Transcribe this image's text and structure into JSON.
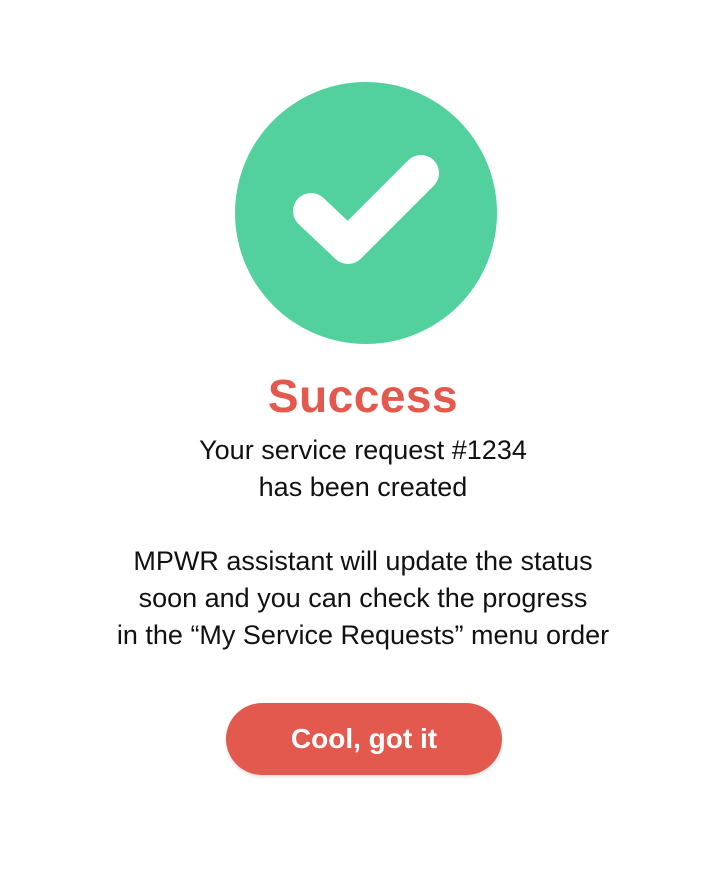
{
  "dialog": {
    "status_icon": "check-circle-icon",
    "title": "Success",
    "message_lines": [
      "Your service request #1234",
      "has been created"
    ],
    "detail_lines": [
      "MPWR assistant will update the status",
      "soon and you can check the progress",
      "in the “My Service Requests” menu order"
    ],
    "confirm_label": "Cool, got it"
  },
  "colors": {
    "success_green": "#52d19e",
    "accent_red": "#e4594d",
    "text": "#111111",
    "background": "#ffffff"
  }
}
